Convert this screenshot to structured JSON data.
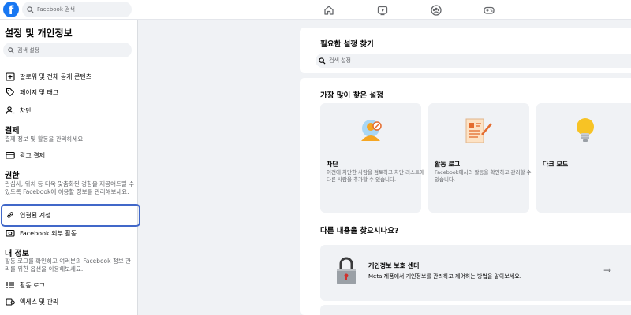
{
  "topbar": {
    "logo": "f",
    "search_placeholder": "Facebook 검색",
    "nav_icons": [
      "home-icon",
      "watch-icon",
      "groups-icon",
      "gaming-icon"
    ]
  },
  "sidebar": {
    "title": "설정 및 개인정보",
    "search_placeholder": "검색 설정",
    "items_top": [
      {
        "label": "팔로워 및 전체 공개 콘텐츠",
        "icon": "public-post-icon"
      },
      {
        "label": "페이지 및 태그",
        "icon": "tag-icon"
      },
      {
        "label": "차단",
        "icon": "block-user-icon"
      }
    ],
    "payments": {
      "heading": "결제",
      "desc": "결제 정보 및 활동을 관리하세요.",
      "item": {
        "label": "광고 결제",
        "icon": "credit-card-icon"
      }
    },
    "permissions": {
      "heading": "권한",
      "desc": "관심사, 위치 등 더욱 맞춤화된 경험을 제공해드릴 수 있도록 Facebook에 허용할 정보를 관리해보세요.",
      "items": [
        {
          "label": "연결된 계정",
          "icon": "link-icon"
        },
        {
          "label": "Facebook 외부 활동",
          "icon": "off-facebook-icon"
        }
      ]
    },
    "my_info": {
      "heading": "내 정보",
      "desc": "활동 로그를 확인하고 여러분의 Facebook 정보 관리를 위한 옵션을 이용해보세요.",
      "items": [
        {
          "label": "활동 로그",
          "icon": "list-icon"
        },
        {
          "label": "액세스 및 관리",
          "icon": "access-icon"
        }
      ]
    }
  },
  "main": {
    "find_title": "필요한 설정 찾기",
    "find_placeholder": "검색 설정",
    "popular_title": "가장 많이 찾은 설정",
    "cards": [
      {
        "title": "차단",
        "desc": "이전에 차단한 사람을 검토하고 차단 리스트에 다른 사람을 추가할 수 있습니다.",
        "icon": "block-illustration-icon"
      },
      {
        "title": "활동 로그",
        "desc": "Facebook에서의 활동을 확인하고 관리할 수 있습니다.",
        "icon": "activity-log-illustration-icon"
      },
      {
        "title": "다크 모드",
        "desc": "",
        "icon": "lightbulb-icon"
      }
    ],
    "more_title": "다른 내용을 찾으시나요?",
    "privacy_center": {
      "title": "개인정보 보호 센터",
      "desc": "Meta 제품에서 개인정보를 관리하고 제어하는 방법을 알아보세요.",
      "arrow": "→",
      "icon": "padlock-icon"
    }
  },
  "colors": {
    "brand": "#1877f2",
    "highlight": "#4168c9",
    "background": "#f0f2f5"
  }
}
